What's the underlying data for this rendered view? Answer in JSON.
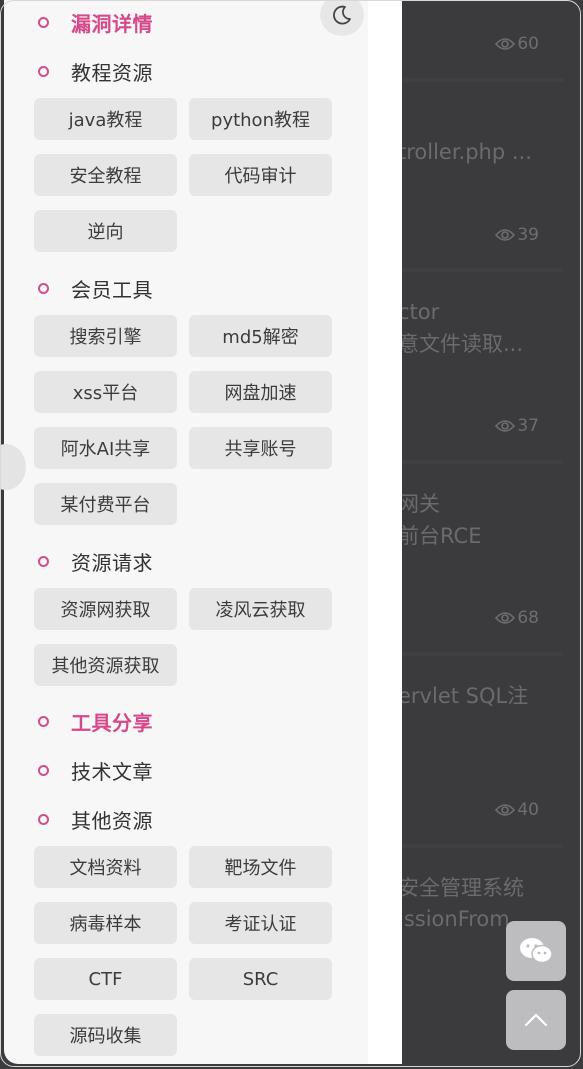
{
  "drawer": {
    "sections": [
      {
        "label": "漏洞详情",
        "active": true
      },
      {
        "label": "教程资源",
        "active": false,
        "items": [
          "java教程",
          "python教程",
          "安全教程",
          "代码审计",
          "逆向"
        ]
      },
      {
        "label": "会员工具",
        "active": false,
        "items": [
          "搜索引擎",
          "md5解密",
          "xss平台",
          "网盘加速",
          "阿水AI共享",
          "共享账号",
          "某付费平台"
        ]
      },
      {
        "label": "资源请求",
        "active": false,
        "items": [
          "资源网获取",
          "凌风云获取",
          "其他资源获取"
        ]
      },
      {
        "label": "工具分享",
        "active": true
      },
      {
        "label": "技术文章",
        "active": false
      },
      {
        "label": "其他资源",
        "active": false,
        "items": [
          "文档资料",
          "靶场文件",
          "病毒样本",
          "考证认证",
          "CTF",
          "SRC",
          "源码收集"
        ]
      }
    ]
  },
  "background": {
    "view_counts": [
      "60",
      "39",
      "37",
      "68",
      "40"
    ],
    "titles": [
      "troller.php ...",
      "ctor",
      "意文件读取...",
      "网关",
      "前台RCE",
      "ervlet SQL注",
      "安全管理系统",
      "issionFrom"
    ]
  },
  "icons": {
    "theme_toggle": "moon-icon",
    "wechat": "wechat-icon",
    "back_to_top": "chevron-up-icon",
    "views": "eye-icon"
  },
  "colors": {
    "accent": "#d5488a",
    "chip_bg": "#e6e6e6",
    "overlay": "#3b3b3e"
  }
}
